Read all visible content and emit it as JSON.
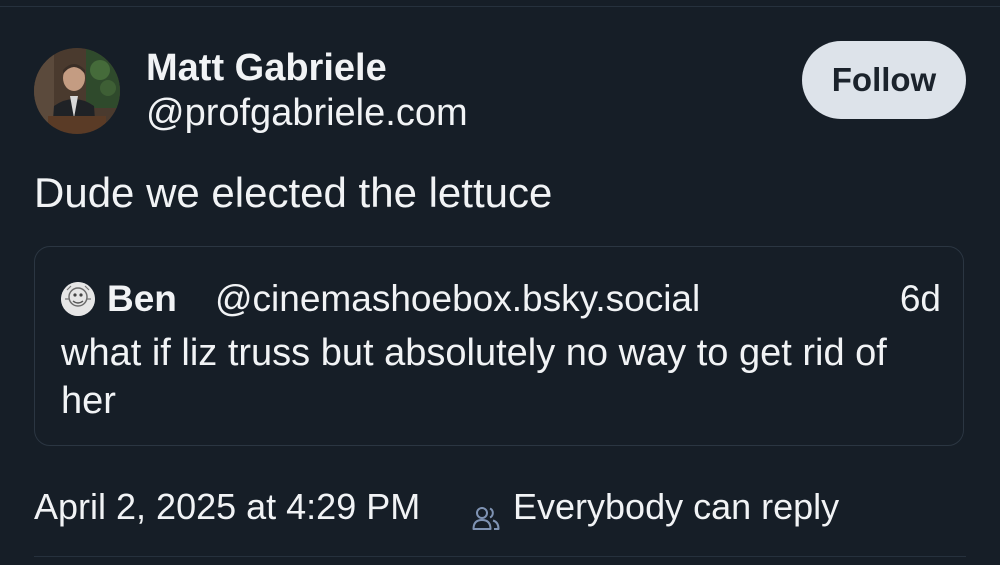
{
  "post": {
    "author": {
      "display_name": "Matt Gabriele",
      "handle": "@profgabriele.com"
    },
    "follow_label": "Follow",
    "text": "Dude we elected the lettuce",
    "quote": {
      "author_name": "Ben",
      "author_handle": "@cinemashoebox.bsky.social",
      "age": "6d",
      "text": "what if liz truss but absolutely no way to get rid of her"
    },
    "timestamp": "April 2, 2025 at 4:29 PM",
    "reply_setting": "Everybody can reply",
    "icons": {
      "reply_setting_icon": "people-icon"
    }
  },
  "colors": {
    "background": "#161e27",
    "text": "#f1f3f5",
    "follow_button_bg": "#dde3ea",
    "border": "#2b3642",
    "icon_accent": "#7f93b3"
  }
}
